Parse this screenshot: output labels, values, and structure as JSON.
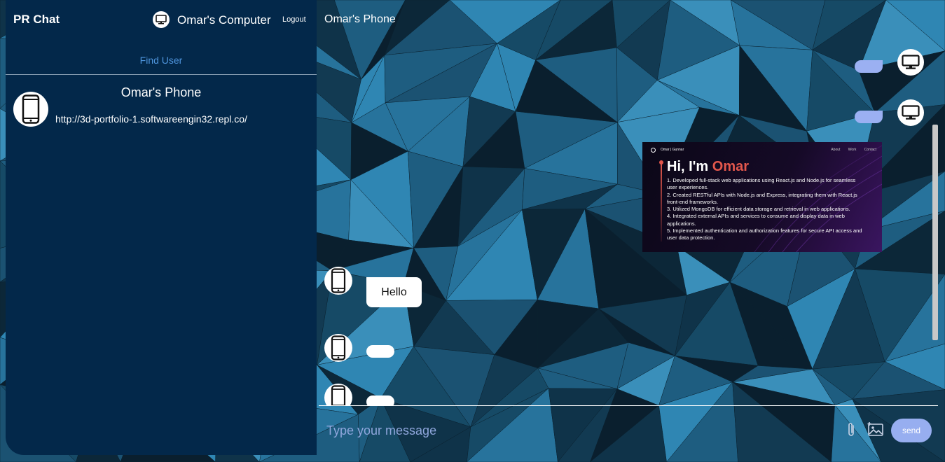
{
  "app": {
    "title": "PR Chat",
    "current_user": "Omar's Computer",
    "logout_label": "Logout"
  },
  "sidebar": {
    "find_user_label": "Find User",
    "users": [
      {
        "name": "Omar's Phone",
        "last_message": "http://3d-portfolio-1.softwareengin32.repl.co/",
        "avatar_icon": "phone-icon"
      }
    ]
  },
  "chat": {
    "title": "Omar's Phone",
    "incoming_avatar_icon": "phone-icon",
    "outgoing_avatar_icon": "monitor-icon",
    "messages": [
      {
        "from": "me",
        "text": ""
      },
      {
        "from": "me",
        "text": ""
      },
      {
        "from": "me",
        "type": "image",
        "image": {
          "nav_brand": "Omar | Gunnar",
          "nav_links": "About Work Contact",
          "heading_prefix": "Hi, I'm",
          "heading_accent": "Omar",
          "lines": [
            "1. Developed full-stack web applications using React.js and Node.js for seamless user experiences.",
            "2. Created RESTful APIs with Node.js and Express, integrating them with React.js front-end frameworks.",
            "3. Utilized MongoDB for efficient data storage and retrieval in web applications.",
            "4. Integrated external APIs and services to consume and display data in web applications.",
            "5. Implemented authentication and authorization features for secure API access and user data protection."
          ]
        }
      },
      {
        "from": "them",
        "text": "Hello"
      },
      {
        "from": "them",
        "text": ""
      },
      {
        "from": "them",
        "text": ""
      }
    ]
  },
  "composer": {
    "placeholder": "Type your message",
    "send_label": "send"
  },
  "colors": {
    "sidebar_bg": "#03284a",
    "outgoing_bubble": "#9bb0f2",
    "incoming_bubble": "#ffffff",
    "accent_link": "#4f95dd",
    "send_button": "#97aef0",
    "portfolio_accent": "#e2574c"
  }
}
